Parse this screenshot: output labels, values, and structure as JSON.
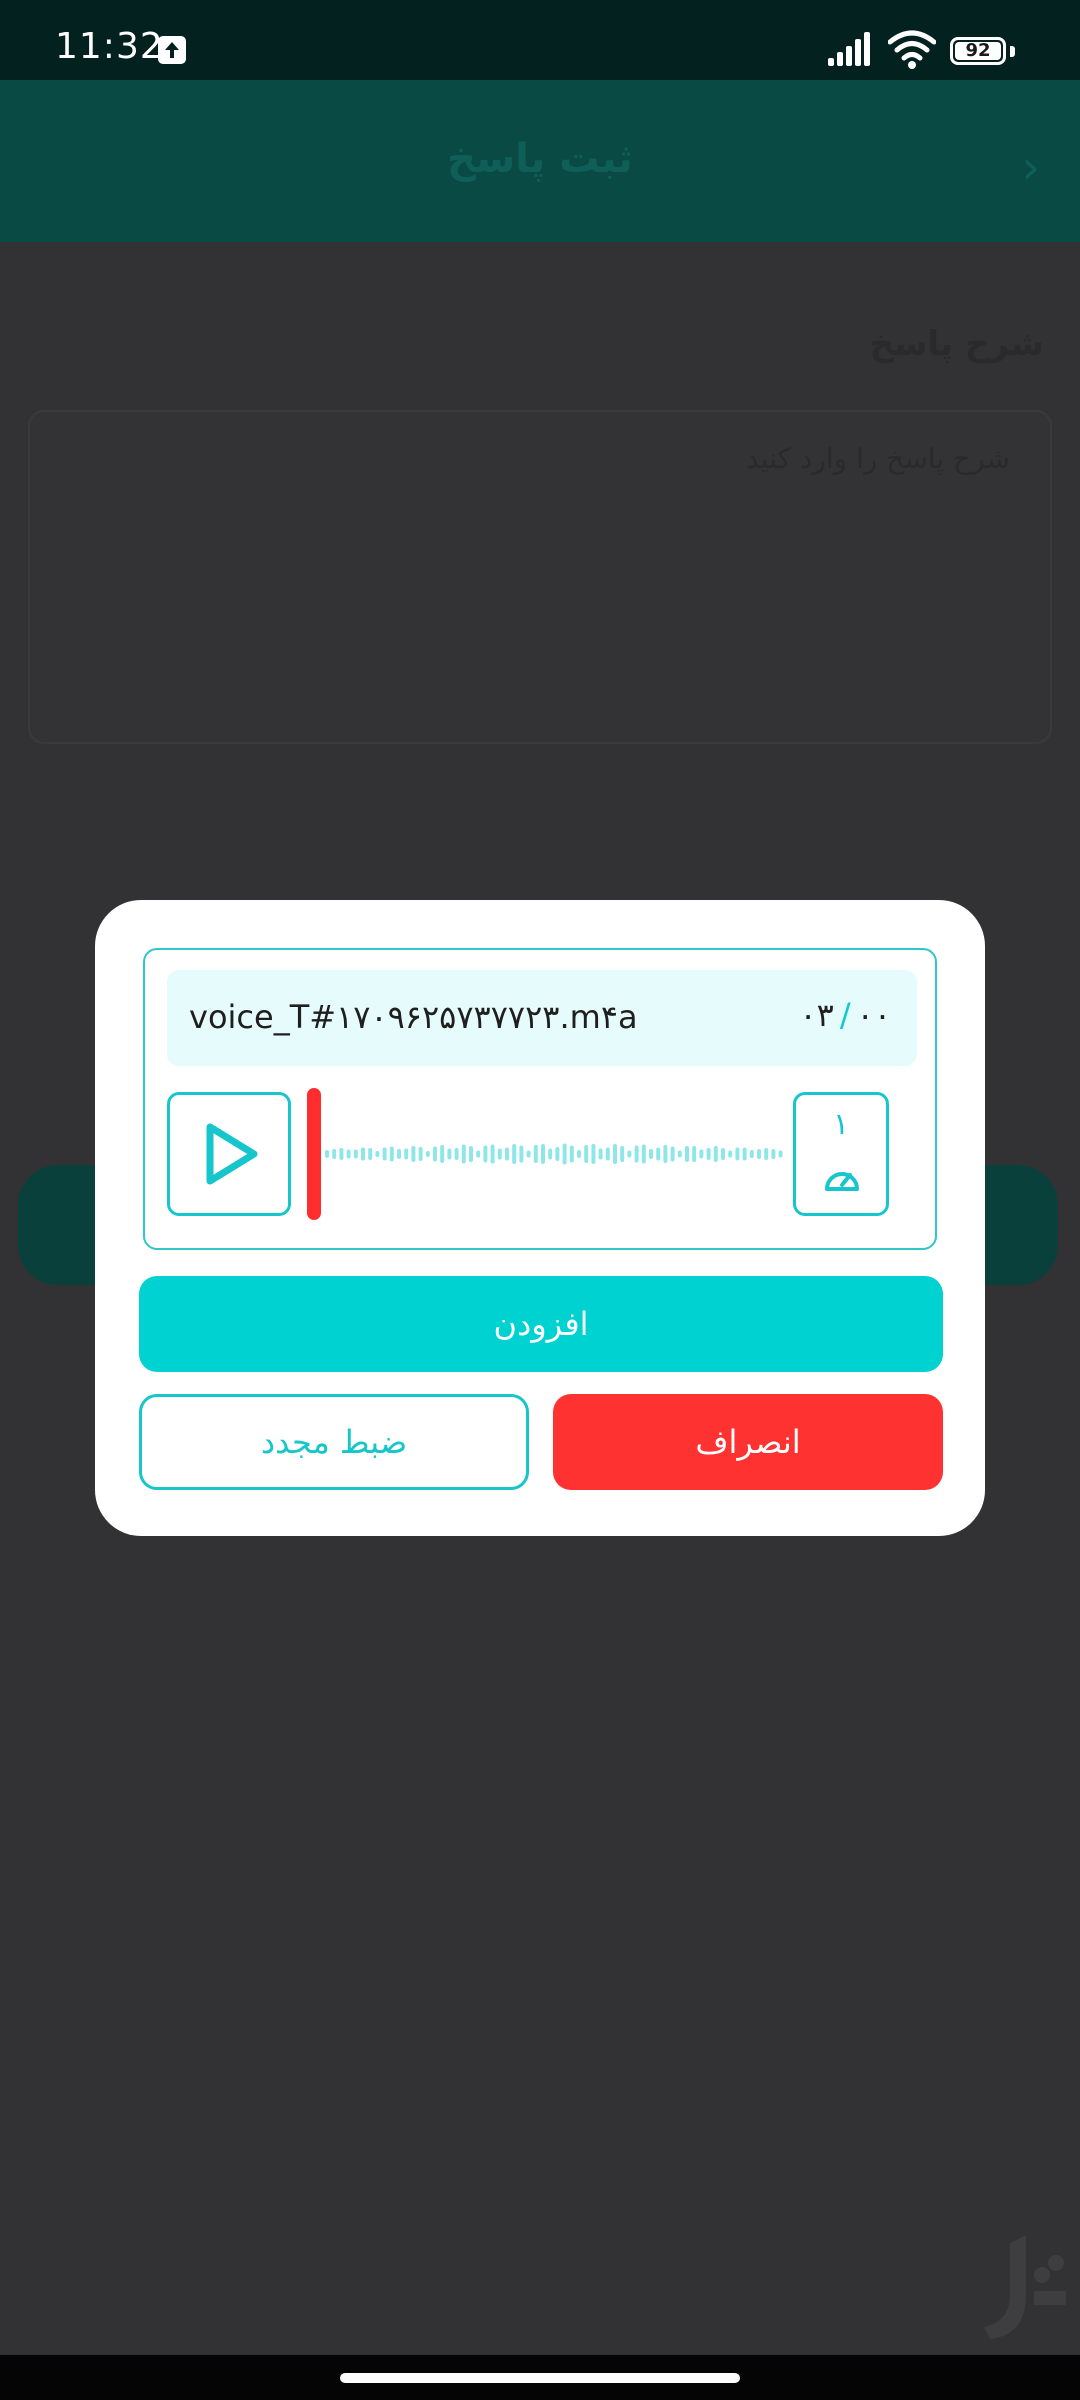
{
  "status_bar": {
    "time": "11:32",
    "battery": "92",
    "icons": [
      "upload-icon",
      "signal-icon",
      "wifi-icon",
      "battery-icon"
    ]
  },
  "app_bar": {
    "title": "ثبت پاسخ",
    "back_icon": "chevron-right-icon"
  },
  "form": {
    "label": "شرح پاسخ",
    "placeholder": "شرح پاسخ را وارد کنید"
  },
  "dialog": {
    "file_name": "voice_T#۱۷۰۹۶۲۵۷۳۷۷۲۳.m۴a",
    "timer": {
      "current": "۰۰",
      "separator": "/",
      "total": "۰۳"
    },
    "speed": "۱",
    "play_icon": "play-icon",
    "speed_icon": "speedometer-icon",
    "add_label": "افزودن",
    "rerecord_label": "ضبط مجدد",
    "cancel_label": "انصراف"
  },
  "colors": {
    "accent": "#00d2d2",
    "danger": "#ff3232",
    "status_bar": "#03211f",
    "app_bar_dimmed": "#0a4a45",
    "overlay": "#323234"
  }
}
